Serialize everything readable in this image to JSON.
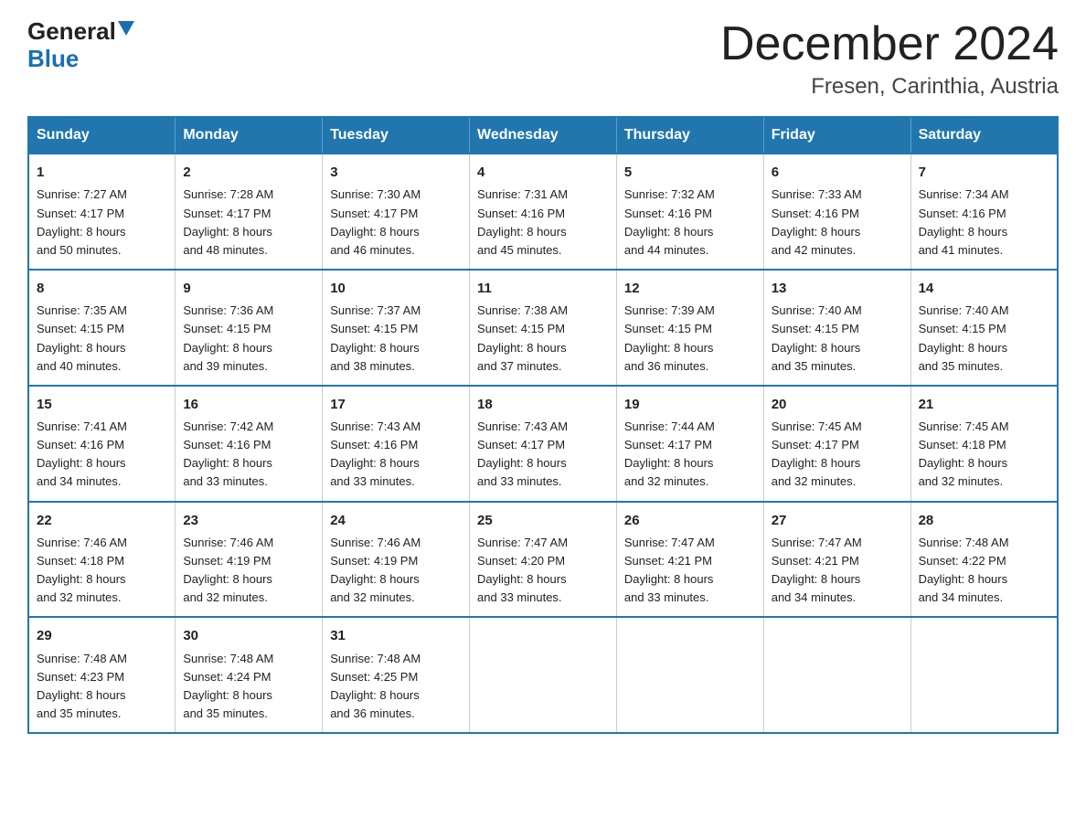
{
  "header": {
    "logo_general": "General",
    "logo_blue": "Blue",
    "title": "December 2024",
    "subtitle": "Fresen, Carinthia, Austria"
  },
  "calendar": {
    "days_of_week": [
      "Sunday",
      "Monday",
      "Tuesday",
      "Wednesday",
      "Thursday",
      "Friday",
      "Saturday"
    ],
    "weeks": [
      [
        {
          "day": "1",
          "sunrise": "7:27 AM",
          "sunset": "4:17 PM",
          "daylight": "8 hours and 50 minutes."
        },
        {
          "day": "2",
          "sunrise": "7:28 AM",
          "sunset": "4:17 PM",
          "daylight": "8 hours and 48 minutes."
        },
        {
          "day": "3",
          "sunrise": "7:30 AM",
          "sunset": "4:17 PM",
          "daylight": "8 hours and 46 minutes."
        },
        {
          "day": "4",
          "sunrise": "7:31 AM",
          "sunset": "4:16 PM",
          "daylight": "8 hours and 45 minutes."
        },
        {
          "day": "5",
          "sunrise": "7:32 AM",
          "sunset": "4:16 PM",
          "daylight": "8 hours and 44 minutes."
        },
        {
          "day": "6",
          "sunrise": "7:33 AM",
          "sunset": "4:16 PM",
          "daylight": "8 hours and 42 minutes."
        },
        {
          "day": "7",
          "sunrise": "7:34 AM",
          "sunset": "4:16 PM",
          "daylight": "8 hours and 41 minutes."
        }
      ],
      [
        {
          "day": "8",
          "sunrise": "7:35 AM",
          "sunset": "4:15 PM",
          "daylight": "8 hours and 40 minutes."
        },
        {
          "day": "9",
          "sunrise": "7:36 AM",
          "sunset": "4:15 PM",
          "daylight": "8 hours and 39 minutes."
        },
        {
          "day": "10",
          "sunrise": "7:37 AM",
          "sunset": "4:15 PM",
          "daylight": "8 hours and 38 minutes."
        },
        {
          "day": "11",
          "sunrise": "7:38 AM",
          "sunset": "4:15 PM",
          "daylight": "8 hours and 37 minutes."
        },
        {
          "day": "12",
          "sunrise": "7:39 AM",
          "sunset": "4:15 PM",
          "daylight": "8 hours and 36 minutes."
        },
        {
          "day": "13",
          "sunrise": "7:40 AM",
          "sunset": "4:15 PM",
          "daylight": "8 hours and 35 minutes."
        },
        {
          "day": "14",
          "sunrise": "7:40 AM",
          "sunset": "4:15 PM",
          "daylight": "8 hours and 35 minutes."
        }
      ],
      [
        {
          "day": "15",
          "sunrise": "7:41 AM",
          "sunset": "4:16 PM",
          "daylight": "8 hours and 34 minutes."
        },
        {
          "day": "16",
          "sunrise": "7:42 AM",
          "sunset": "4:16 PM",
          "daylight": "8 hours and 33 minutes."
        },
        {
          "day": "17",
          "sunrise": "7:43 AM",
          "sunset": "4:16 PM",
          "daylight": "8 hours and 33 minutes."
        },
        {
          "day": "18",
          "sunrise": "7:43 AM",
          "sunset": "4:17 PM",
          "daylight": "8 hours and 33 minutes."
        },
        {
          "day": "19",
          "sunrise": "7:44 AM",
          "sunset": "4:17 PM",
          "daylight": "8 hours and 32 minutes."
        },
        {
          "day": "20",
          "sunrise": "7:45 AM",
          "sunset": "4:17 PM",
          "daylight": "8 hours and 32 minutes."
        },
        {
          "day": "21",
          "sunrise": "7:45 AM",
          "sunset": "4:18 PM",
          "daylight": "8 hours and 32 minutes."
        }
      ],
      [
        {
          "day": "22",
          "sunrise": "7:46 AM",
          "sunset": "4:18 PM",
          "daylight": "8 hours and 32 minutes."
        },
        {
          "day": "23",
          "sunrise": "7:46 AM",
          "sunset": "4:19 PM",
          "daylight": "8 hours and 32 minutes."
        },
        {
          "day": "24",
          "sunrise": "7:46 AM",
          "sunset": "4:19 PM",
          "daylight": "8 hours and 32 minutes."
        },
        {
          "day": "25",
          "sunrise": "7:47 AM",
          "sunset": "4:20 PM",
          "daylight": "8 hours and 33 minutes."
        },
        {
          "day": "26",
          "sunrise": "7:47 AM",
          "sunset": "4:21 PM",
          "daylight": "8 hours and 33 minutes."
        },
        {
          "day": "27",
          "sunrise": "7:47 AM",
          "sunset": "4:21 PM",
          "daylight": "8 hours and 34 minutes."
        },
        {
          "day": "28",
          "sunrise": "7:48 AM",
          "sunset": "4:22 PM",
          "daylight": "8 hours and 34 minutes."
        }
      ],
      [
        {
          "day": "29",
          "sunrise": "7:48 AM",
          "sunset": "4:23 PM",
          "daylight": "8 hours and 35 minutes."
        },
        {
          "day": "30",
          "sunrise": "7:48 AM",
          "sunset": "4:24 PM",
          "daylight": "8 hours and 35 minutes."
        },
        {
          "day": "31",
          "sunrise": "7:48 AM",
          "sunset": "4:25 PM",
          "daylight": "8 hours and 36 minutes."
        },
        null,
        null,
        null,
        null
      ]
    ]
  }
}
